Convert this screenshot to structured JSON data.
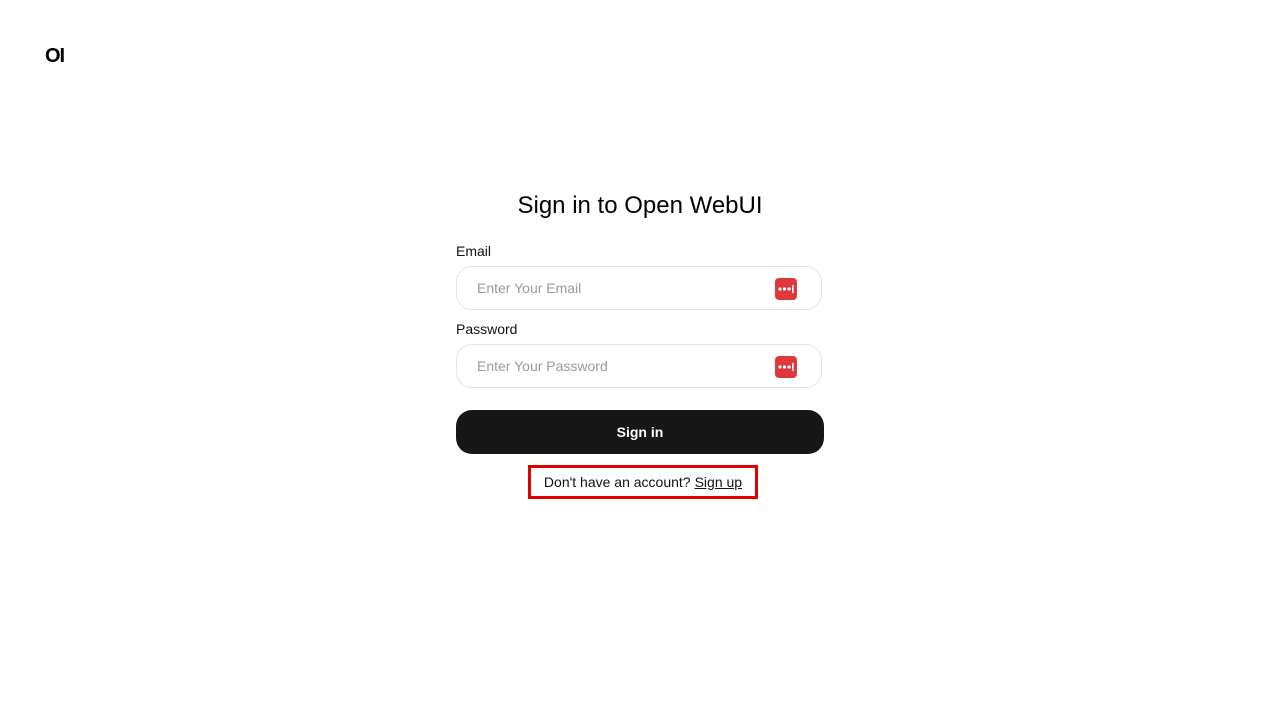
{
  "brand": {
    "logo_text": "OI"
  },
  "auth": {
    "title": "Sign in to Open WebUI",
    "email": {
      "label": "Email",
      "placeholder": "Enter Your Email",
      "value": ""
    },
    "password": {
      "label": "Password",
      "placeholder": "Enter Your Password",
      "value": ""
    },
    "signin_label": "Sign in",
    "signup_prompt": "Don't have an account?",
    "signup_link": "Sign up"
  },
  "icons": {
    "password_manager": "password-manager-icon"
  },
  "colors": {
    "button_bg": "#171717",
    "password_manager_icon": "#e0393b",
    "highlight_border": "#e00000"
  }
}
